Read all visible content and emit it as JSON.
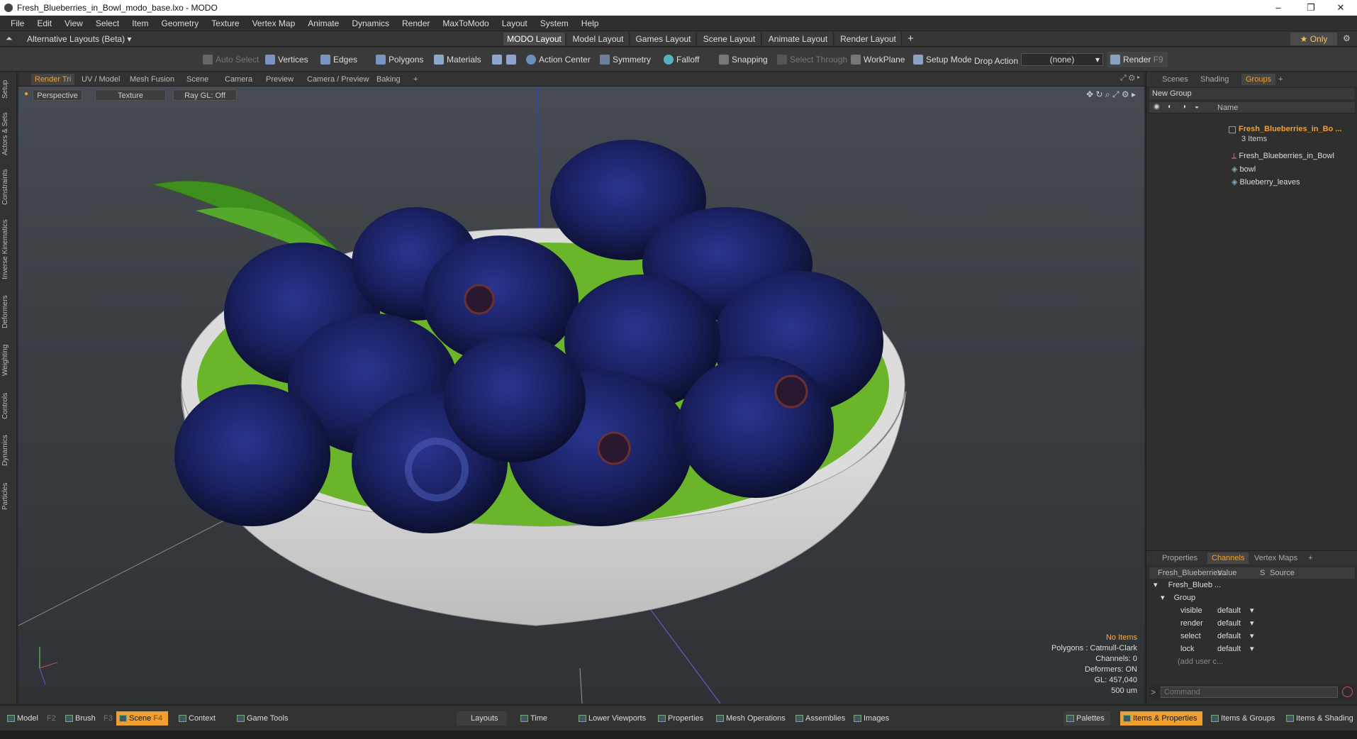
{
  "titlebar": {
    "title": "Fresh_Blueberries_in_Bowl_modo_base.lxo - MODO",
    "minimize": "–",
    "restore": "❐",
    "close": "✕"
  },
  "menu": [
    "File",
    "Edit",
    "View",
    "Select",
    "Item",
    "Geometry",
    "Texture",
    "Vertex Map",
    "Animate",
    "Dynamics",
    "Render",
    "MaxToModo",
    "Layout",
    "System",
    "Help"
  ],
  "layoutbar": {
    "left_label": "Alternative Layouts (Beta)",
    "tabs": [
      "MODO Layout",
      "Model Layout",
      "Games Layout",
      "Scene Layout",
      "Animate Layout",
      "Render Layout"
    ],
    "active_tab": "MODO Layout",
    "add": "+",
    "only": "Only"
  },
  "toolbar": {
    "auto_select": "Auto Select",
    "vertices": "Vertices",
    "edges": "Edges",
    "polygons": "Polygons",
    "materials": "Materials",
    "action_center": "Action Center",
    "symmetry": "Symmetry",
    "falloff": "Falloff",
    "snapping": "Snapping",
    "select_through": "Select Through",
    "workplane": "WorkPlane",
    "setup_mode": "Setup Mode",
    "drop_action": "Drop Action",
    "drop_value": "(none)",
    "render": "Render",
    "render_key": "F9"
  },
  "left_tabs": [
    "Setup",
    "Actors & Sets",
    "Constraints",
    "Inverse Kinematics",
    "Deformers",
    "Weighting",
    "Controls",
    "Dynamics",
    "Particles"
  ],
  "viewport_tabs": [
    "Render Tri",
    "UV / Model",
    "Mesh Fusion",
    "Scene",
    "Camera",
    "Preview",
    "Camera / Preview",
    "Baking",
    "+"
  ],
  "viewport": {
    "perspective": "Perspective",
    "texture": "Texture",
    "raygl": "Ray GL: Off",
    "info": {
      "no_items": "No Items",
      "polygons": "Polygons : Catmull-Clark",
      "channels": "Channels: 0",
      "deformers": "Deformers: ON",
      "gl": "GL: 457,040",
      "scale": "500 um"
    }
  },
  "groups_panel": {
    "tabs": [
      "Scenes",
      "Shading",
      "Groups",
      "+"
    ],
    "active_tab": "Groups",
    "new_group": "New Group",
    "col_name": "Name",
    "group_name": "Fresh_Blueberries_in_Bo ...",
    "group_count": "3 Items",
    "items": [
      "Fresh_Blueberries_in_Bowl",
      "bowl",
      "Blueberry_leaves"
    ]
  },
  "channels_panel": {
    "tabs": [
      "Properties",
      "Channels",
      "Vertex Maps",
      "+"
    ],
    "active_tab": "Channels",
    "col_item": "Fresh_Blueberries...",
    "col_value": "Value",
    "col_s": "S",
    "col_source": "Source",
    "root": "Fresh_Blueb ...",
    "group": "Group",
    "rows": [
      {
        "name": "visible",
        "value": "default"
      },
      {
        "name": "render",
        "value": "default"
      },
      {
        "name": "select",
        "value": "default"
      },
      {
        "name": "lock",
        "value": "default"
      }
    ],
    "add_user": "(add user c...",
    "command_placeholder": "Command"
  },
  "bottombar": {
    "model": "Model",
    "model_key": "F2",
    "brush": "Brush",
    "brush_key": "F3",
    "scene": "Scene",
    "scene_key": "F4",
    "context": "Context",
    "game_tools": "Game Tools",
    "layouts": "Layouts",
    "time": "Time",
    "lower_viewports": "Lower Viewports",
    "properties": "Properties",
    "mesh_operations": "Mesh Operations",
    "assemblies": "Assemblies",
    "images": "Images",
    "palettes": "Palettes",
    "items_properties": "Items & Properties",
    "items_groups": "Items & Groups",
    "items_shading": "Items & Shading"
  },
  "colors": {
    "accent": "#f0a030",
    "blueberry": "#1c2466",
    "leaf": "#3f8f1e",
    "bowl": "#d8d8d8",
    "bowl_inner": "#6ab52a"
  }
}
